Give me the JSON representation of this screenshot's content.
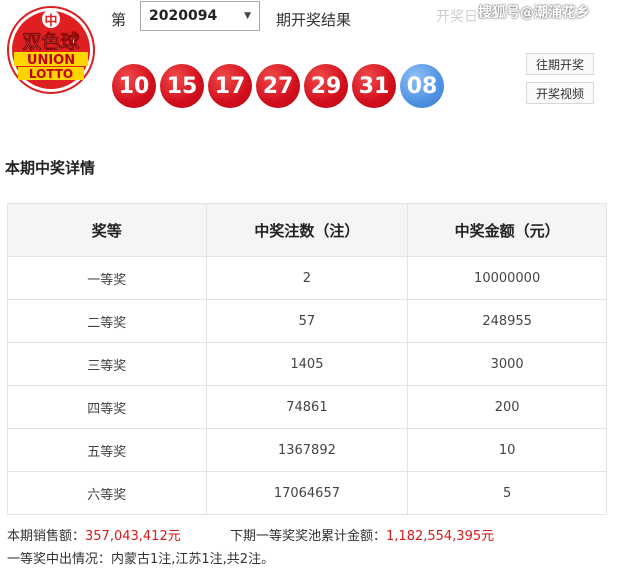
{
  "logo": {
    "brand_cn": "双色球",
    "brand_en_1": "UNION",
    "brand_en_2": "LOTTO"
  },
  "header": {
    "issue_label": "第",
    "issue_value": "2020094",
    "result_label": "期开奖结果",
    "date_text": "开奖日",
    "watermark": "搜狐号@潮涌花乡"
  },
  "balls": {
    "red": [
      "10",
      "15",
      "17",
      "27",
      "29",
      "31"
    ],
    "blue": "08",
    "colors": {
      "red": "#d10f1c",
      "blue": "#4f92e3"
    }
  },
  "buttons": {
    "history": "往期开奖",
    "video": "开奖视频"
  },
  "section_title": "本期中奖详情",
  "table": {
    "headers": [
      "奖等",
      "中奖注数（注）",
      "中奖金额（元）"
    ],
    "rows": [
      [
        "一等奖",
        "2",
        "10000000"
      ],
      [
        "二等奖",
        "57",
        "248955"
      ],
      [
        "三等奖",
        "1405",
        "3000"
      ],
      [
        "四等奖",
        "74861",
        "200"
      ],
      [
        "五等奖",
        "1367892",
        "10"
      ],
      [
        "六等奖",
        "17064657",
        "5"
      ]
    ]
  },
  "footer": {
    "sales_label": "本期销售额：",
    "sales_value": "357,043,412元",
    "pool_label": "下期一等奖奖池累计金额：",
    "pool_value": "1,182,554,395元",
    "winners_text": "一等奖中出情况：内蒙古1注,江苏1注,共2注。"
  }
}
